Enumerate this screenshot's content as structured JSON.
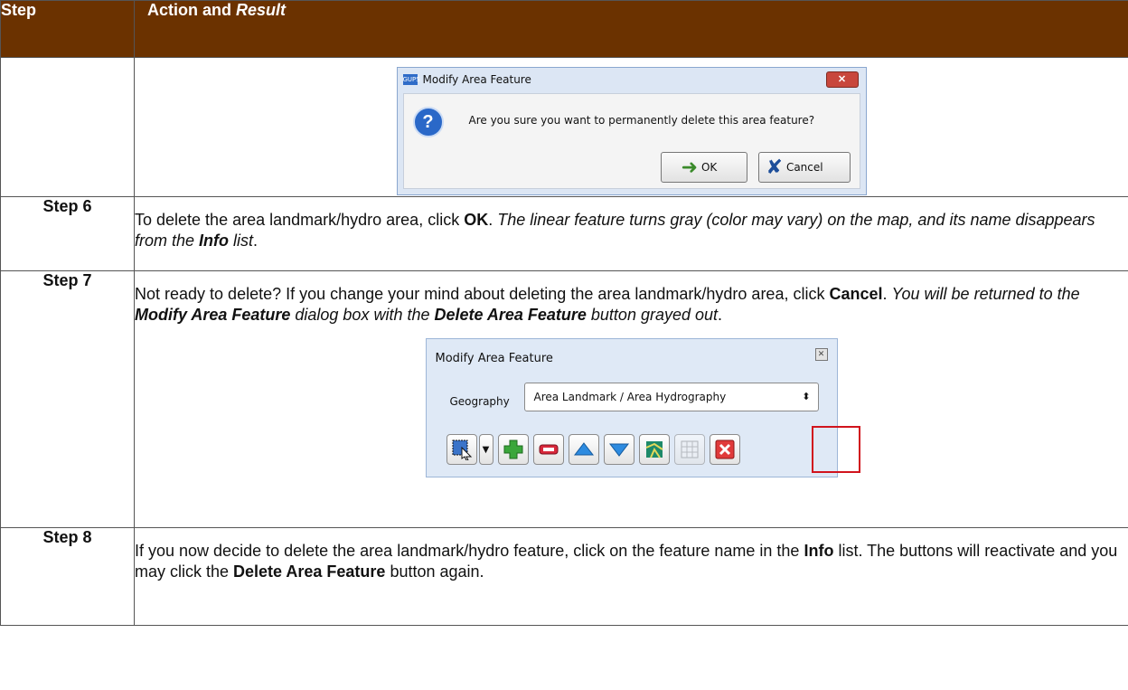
{
  "header": {
    "col1": "Step",
    "col2_plain": "Action and ",
    "col2_italic": "Result"
  },
  "dialog1": {
    "app_badge": "GUPS",
    "title": "Modify Area Feature",
    "message": "Are you sure you want to permanently delete this area feature?",
    "ok_label": "OK",
    "cancel_label": "Cancel"
  },
  "rows": [
    {
      "step": "Step 6",
      "parts": [
        "To delete the area landmark/hydro area, click ",
        "OK",
        ". ",
        "The linear feature turns gray (color may vary) on the map, and its name disappears from the ",
        "Info",
        " list",
        "."
      ]
    },
    {
      "step": "Step 7",
      "parts": [
        "Not ready to delete? If you change your mind about deleting the area landmark/hydro area, click ",
        "Cancel",
        ". ",
        "You will be returned to the ",
        "Modify Area Feature",
        " dialog box with the ",
        "Delete Area Feature",
        " button grayed out",
        "."
      ]
    },
    {
      "step": "Step 8",
      "parts": [
        "If you now decide to delete the area landmark/hydro feature, click on the feature name in the ",
        "Info",
        " list. The buttons will reactivate and you may click the ",
        "Delete Area Feature",
        " button again."
      ]
    }
  ],
  "dialog2": {
    "title": "Modify Area Feature",
    "geography_label": "Geography",
    "geography_value": "Area Landmark / Area Hydrography",
    "toolbar_icons": [
      "select-tool-icon",
      "dropdown-arrow-icon",
      "add-icon",
      "remove-icon",
      "move-up-icon",
      "move-down-icon",
      "map-icon",
      "table-icon",
      "delete-icon"
    ]
  }
}
